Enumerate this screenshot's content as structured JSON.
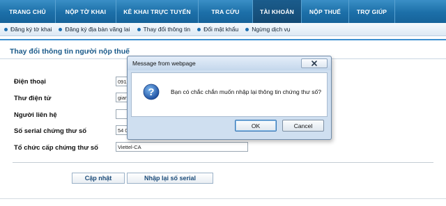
{
  "nav": {
    "items": [
      {
        "label": "TRANG CHỦ"
      },
      {
        "label": "NỘP TỜ KHAI"
      },
      {
        "label": "KÊ KHAI TRỰC TUYẾN"
      },
      {
        "label": "TRA CỨU"
      },
      {
        "label": "TÀI KHOẢN"
      },
      {
        "label": "NỘP THUẾ"
      },
      {
        "label": "TRỢ GIÚP"
      }
    ],
    "active": "TÀI KHOẢN"
  },
  "subnav": {
    "items": [
      {
        "label": "Đăng ký tờ khai"
      },
      {
        "label": "Đăng ký địa bàn vãng lai"
      },
      {
        "label": "Thay đổi thông tin"
      },
      {
        "label": "Đổi mật khẩu"
      },
      {
        "label": "Ngừng dịch vụ"
      }
    ]
  },
  "page": {
    "title": "Thay đổi thông tin người nộp thuế"
  },
  "form": {
    "phone": {
      "label": "Điện thoại",
      "value": "0912"
    },
    "email": {
      "label": "Thư điện tử",
      "value": "gian"
    },
    "contact": {
      "label": "Người liên hệ",
      "value": ""
    },
    "serial": {
      "label": "Số serial chứng thư số",
      "value": "54 0"
    },
    "issuer": {
      "label": "Tổ chức cấp chứng thư số",
      "value": "Viettel-CA"
    },
    "update_label": "Cập nhật",
    "reenter_label": "Nhập lại số serial"
  },
  "dialog": {
    "title": "Message from webpage",
    "message": "Bạn có chắc chắn muốn nhập lại thông tin chứng thư số?",
    "ok_label": "OK",
    "cancel_label": "Cancel",
    "close_icon": "close-icon",
    "message_icon": "help-icon"
  },
  "colors": {
    "nav_bg": "#1c6fa8",
    "nav_active": "#134a74",
    "title": "#1a5a8a",
    "accent_line": "#3b8fd0"
  }
}
